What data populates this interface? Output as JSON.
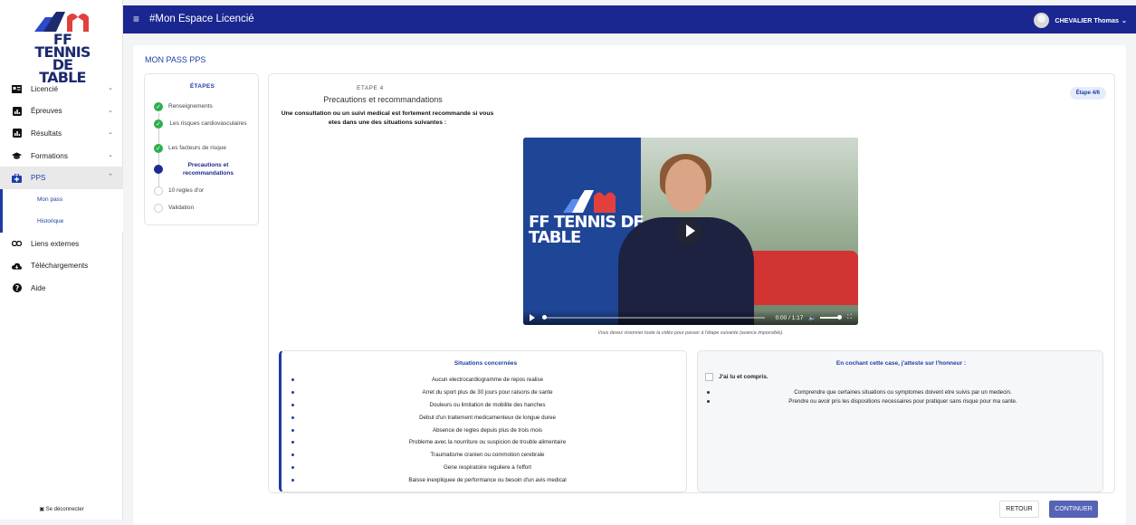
{
  "brand": {
    "logo_text": "FF TENNIS DE TABLE",
    "primary_color": "#1a2790",
    "accent_red": "#e2403d"
  },
  "header": {
    "app_title": "#Mon Espace Licencié",
    "user_name": "CHEVALIER Thomas"
  },
  "sidebar": {
    "items": [
      {
        "label": "Licencié",
        "icon": "id-card-icon"
      },
      {
        "label": "Épreuves",
        "icon": "chart-icon"
      },
      {
        "label": "Résultats",
        "icon": "chart-icon"
      },
      {
        "label": "Formations",
        "icon": "graduation-cap-icon"
      },
      {
        "label": "PPS",
        "icon": "medical-bag-icon"
      },
      {
        "label": "Liens externes",
        "icon": "link-icon"
      },
      {
        "label": "Téléchargements",
        "icon": "cloud-download-icon"
      },
      {
        "label": "Aide",
        "icon": "help-icon"
      }
    ],
    "sub_items": [
      "Mon pass",
      "Historique"
    ],
    "logout": "Se déconnecter"
  },
  "page": {
    "title": "MON PASS PPS"
  },
  "steps": {
    "heading": "ÉTAPES",
    "items": [
      {
        "label": "Renseignements",
        "state": "done"
      },
      {
        "label": "Les risques cardiovasculaires",
        "state": "done"
      },
      {
        "label": "Les facteurs de risque",
        "state": "done"
      },
      {
        "label": "Precautions et recommandations",
        "state": "current"
      },
      {
        "label": "10 regles d'or",
        "state": "todo"
      },
      {
        "label": "Validation",
        "state": "todo"
      }
    ]
  },
  "etape": {
    "number": "ETAPE 4",
    "title": "Precautions et recommandations",
    "description": "Une consultation ou un suivi medical est fortement recommande si vous etes dans une des situations suivantes :",
    "badge": "Étape 4/6"
  },
  "video": {
    "time": "0:00 / 1:17",
    "progress": 0.0,
    "note": "Vous devez visionner toute la vidéo pour passer à l'étape suivante (avance impossible).",
    "overlay_text": "FF TENNIS DE TABLE"
  },
  "situations": {
    "title": "Situations concernées",
    "items": [
      "Aucun electrocardiogramme de repos realise",
      "Arret du sport plus de 30 jours pour raisons de sante",
      "Douleurs ou limitation de mobilite des hanches",
      "Debut d'un traitement medicamenteux de longue duree",
      "Absence de regles depuis plus de trois mois",
      "Probleme avec la nourriture ou suspicion de trouble alimentaire",
      "Traumatisme cranien ou commotion cerebrale",
      "Gene respiratoire reguliere a l'effort",
      "Baisse inexpliquee de performance ou besoin d'un avis medical"
    ]
  },
  "attestation": {
    "title": "En cochant cette case, j'atteste sur l'honneur :",
    "checkbox_label": "J'ai lu et compris.",
    "checked": false,
    "items": [
      "Comprendre que certaines situations ou symptomes doivent etre suivis par un medecin.",
      "Prendre ou avoir pris les dispositions necessaires pour pratiquer sans risque pour ma sante."
    ]
  },
  "actions": {
    "back": "RETOUR",
    "continue": "CONTINUER"
  }
}
